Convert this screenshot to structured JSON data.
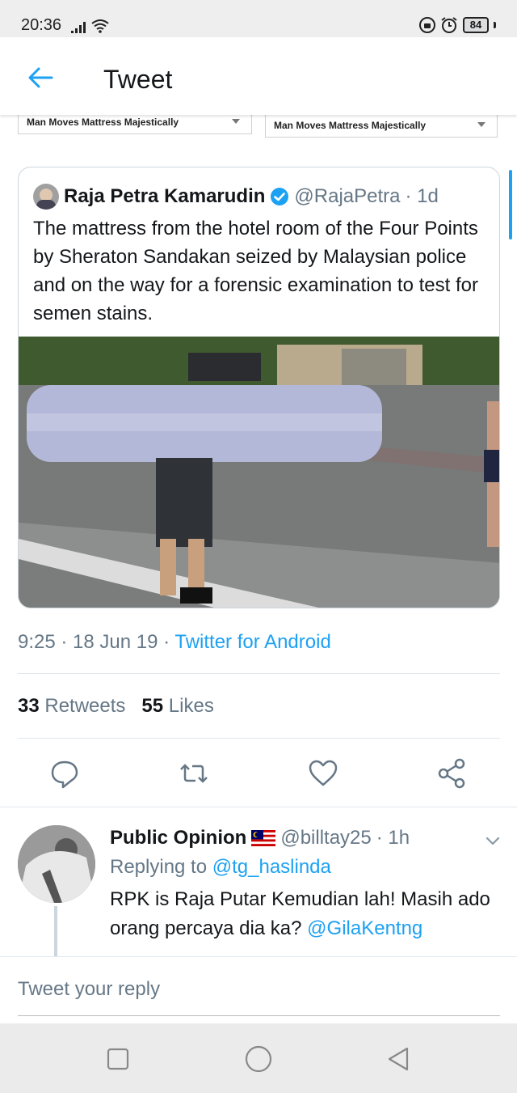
{
  "status_bar": {
    "time": "20:36",
    "battery": "84",
    "icons": [
      "signal-icon",
      "wifi-icon",
      "vpn-lock-icon",
      "alarm-icon",
      "battery-icon"
    ]
  },
  "header": {
    "back_icon": "arrow-left-icon",
    "title": "Tweet"
  },
  "embedded_dropdowns": {
    "left_label": "Man Moves Mattress Majestically",
    "right_label": "Man Moves Mattress Majestically"
  },
  "quoted_tweet": {
    "name": "Raja Petra Kamarudin",
    "verified": true,
    "handle": "@RajaPetra",
    "age": "· 1d",
    "text": "The mattress from the hotel room of the Four Points by Sheraton Sandakan seized by Malaysian police and on the way for a forensic examination to test for semen stains."
  },
  "tweet_meta": {
    "time": "9:25",
    "date": "· 18 Jun 19 ·",
    "source": "Twitter for Android"
  },
  "stats": {
    "retweets_count": "33",
    "retweets_label": "Retweets",
    "likes_count": "55",
    "likes_label": "Likes"
  },
  "actions": [
    "reply-icon",
    "retweet-icon",
    "like-icon",
    "share-icon"
  ],
  "reply": {
    "name": "Public Opinion",
    "flag": "malaysia-flag-icon",
    "handle": "@billtay25",
    "age": "· 1h",
    "replying_prefix": "Replying to",
    "replying_to": "@tg_haslinda",
    "text": "RPK is Raja Putar Kemudian lah! Masih ado orang percaya dia ka?",
    "mention": "@GilaKentng"
  },
  "compose": {
    "placeholder": "Tweet your reply"
  },
  "colors": {
    "accent": "#1da1f2",
    "secondary_text": "#657786",
    "divider": "#e1e8ed"
  }
}
